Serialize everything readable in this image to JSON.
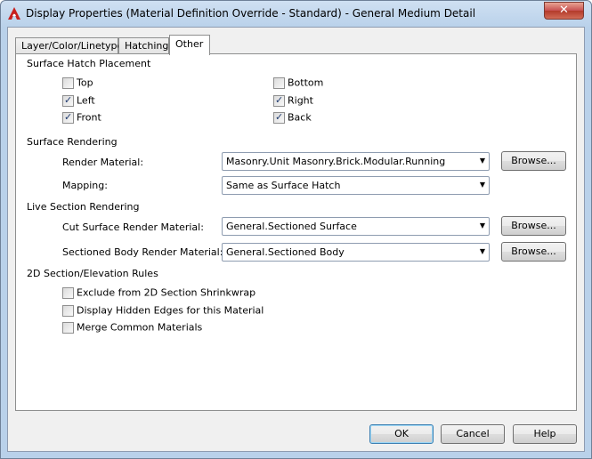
{
  "window": {
    "title": "Display Properties (Material Definition Override - Standard) - General Medium Detail",
    "close_glyph": "✕",
    "app_icon": "autocad-a-icon"
  },
  "tabs": [
    {
      "label": "Layer/Color/Linetype"
    },
    {
      "label": "Hatching"
    },
    {
      "label": "Other"
    }
  ],
  "surface_hatch_placement": {
    "heading": "Surface Hatch Placement",
    "options": [
      {
        "label": "Top",
        "checked": false
      },
      {
        "label": "Left",
        "checked": true
      },
      {
        "label": "Front",
        "checked": true
      },
      {
        "label": "Bottom",
        "checked": false
      },
      {
        "label": "Right",
        "checked": true
      },
      {
        "label": "Back",
        "checked": true
      }
    ]
  },
  "surface_rendering": {
    "heading": "Surface Rendering",
    "render_material_label": "Render Material:",
    "render_material_value": "Masonry.Unit Masonry.Brick.Modular.Running",
    "mapping_label": "Mapping:",
    "mapping_value": "Same as Surface Hatch",
    "browse_label": "Browse..."
  },
  "live_section_rendering": {
    "heading": "Live Section Rendering",
    "cut_surface_label": "Cut Surface Render Material:",
    "cut_surface_value": "General.Sectioned Surface",
    "sectioned_body_label": "Sectioned Body Render Material:",
    "sectioned_body_value": "General.Sectioned Body",
    "browse_label": "Browse..."
  },
  "section_elevation_rules": {
    "heading": "2D Section/Elevation Rules",
    "options": [
      {
        "label": "Exclude from 2D Section Shrinkwrap",
        "checked": false
      },
      {
        "label": "Display Hidden Edges for this Material",
        "checked": false
      },
      {
        "label": "Merge Common Materials",
        "checked": false
      }
    ]
  },
  "footer": {
    "ok_label": "OK",
    "cancel_label": "Cancel",
    "help_label": "Help"
  },
  "check_glyph": "✓",
  "dropdown_glyph": "▼"
}
